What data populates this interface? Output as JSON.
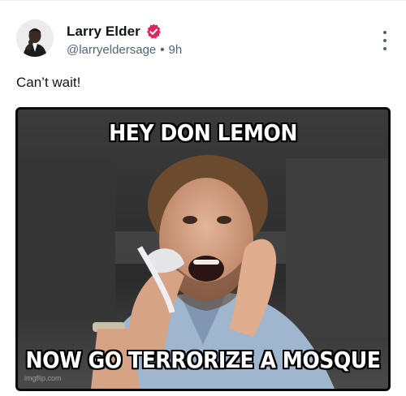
{
  "post": {
    "author_name": "Larry Elder",
    "handle": "@larryeldersage",
    "separator": "•",
    "time": "9h",
    "text": "Can’t wait!"
  },
  "meme": {
    "top_text": "HEY DON LEMON",
    "bottom_text": "NOW GO TERRORIZE A MOSQUE",
    "watermark": "imgflip.com"
  },
  "colors": {
    "verified_badge": "#e0245e",
    "secondary_text": "#536471",
    "primary_text": "#0f1419"
  },
  "icons": {
    "verified": "verified-badge-icon",
    "more": "more-options-icon"
  }
}
